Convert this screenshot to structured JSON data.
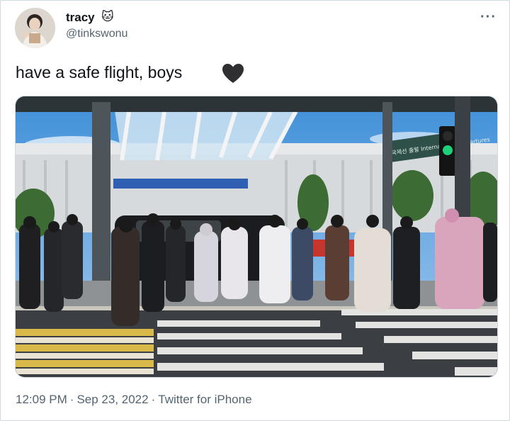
{
  "user": {
    "display_name": "tracy",
    "name_emoji": "🐱",
    "handle": "@tinkswonu"
  },
  "tweet": {
    "text": "have a safe flight, boys",
    "emoji_icon": "black-heart-icon"
  },
  "meta": {
    "time": "12:09 PM",
    "date": "Sep 23, 2022",
    "source": "Twitter for iPhone",
    "separator": "·"
  },
  "colors": {
    "text": "#0f1419",
    "secondary": "#536471",
    "border": "#cfd9de"
  },
  "media": {
    "sign_text": "국제선 출발 International Departures"
  }
}
